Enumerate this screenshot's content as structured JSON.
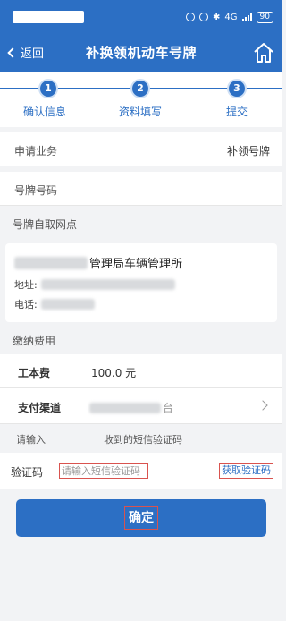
{
  "status_bar": {
    "battery": "90",
    "network": "4G"
  },
  "nav": {
    "back_label": "返回",
    "title": "补换领机动车号牌"
  },
  "steps": [
    {
      "number": "1",
      "label": "确认信息"
    },
    {
      "number": "2",
      "label": "资料填写"
    },
    {
      "number": "3",
      "label": "提交"
    }
  ],
  "business": {
    "label": "申请业务",
    "value": "补领号牌"
  },
  "plate": {
    "label": "号牌号码",
    "value": ""
  },
  "pickup": {
    "section_title": "号牌自取网点",
    "name_suffix": "管理局车辆管理所",
    "address_label": "地址:",
    "phone_label": "电话:"
  },
  "fees": {
    "section_title": "缴纳费用",
    "cost_label": "工本费",
    "cost_value": "100.0 元",
    "channel_label": "支付渠道",
    "channel_value_suffix": "台"
  },
  "sms_hint": {
    "prefix": "请输入",
    "suffix": "收到的短信验证码"
  },
  "verification": {
    "label": "验证码",
    "placeholder": "请输入短信验证码",
    "get_code_label": "获取验证码"
  },
  "confirm_label": "确定",
  "colors": {
    "primary": "#2c6fc4",
    "highlight_border": "#d9534f",
    "background": "#f2f3f5"
  }
}
